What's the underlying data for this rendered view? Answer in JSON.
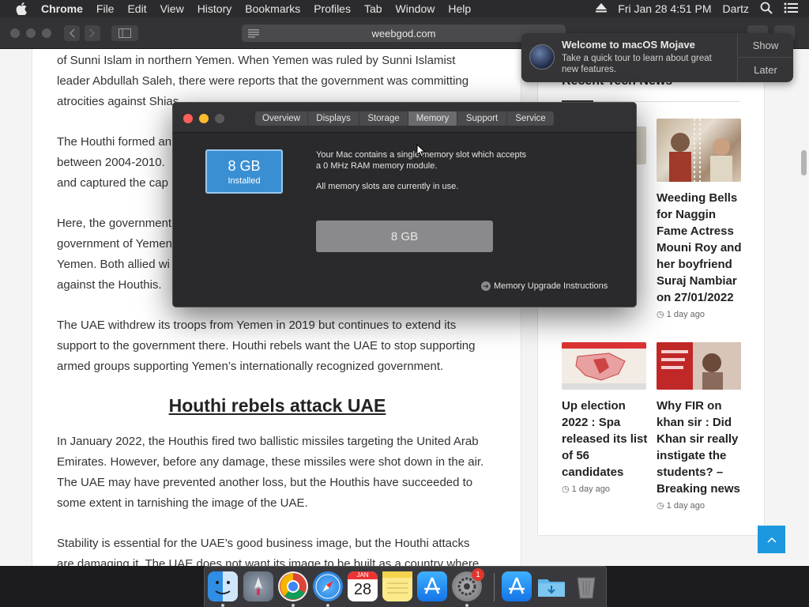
{
  "menubar": {
    "app": "Chrome",
    "items": [
      "File",
      "Edit",
      "View",
      "History",
      "Bookmarks",
      "Profiles",
      "Tab",
      "Window",
      "Help"
    ],
    "datetime": "Fri Jan 28  4:51 PM",
    "user": "Dartz"
  },
  "browser": {
    "url": "weebgod.com"
  },
  "notification": {
    "title": "Welcome to macOS Mojave",
    "body_lines": [
      "Take a quick tour to learn about great",
      "new features."
    ],
    "show_label": "Show",
    "later_label": "Later"
  },
  "article": {
    "paragraphs": [
      {
        "lines": [
          "of Sunni Islam in northern Yemen. When Yemen was ruled by Sunni Islamist",
          "leader Abdullah Saleh, there were reports that the government was committing",
          "atrocities against Shias."
        ]
      },
      {
        "lines": [
          "The Houthi formed an",
          "between 2004-2010.",
          "and captured the cap"
        ]
      },
      {
        "lines": [
          "Here, the government",
          "government of Yemen",
          "Yemen. Both allied wi",
          "against the Houthis."
        ]
      },
      {
        "lines": [
          "The UAE withdrew its troops from Yemen in 2019 but continues to extend its",
          "support to the government there. Houthi rebels want the UAE to stop supporting",
          "armed groups supporting Yemen’s internationally recognized government."
        ]
      },
      {
        "lines": [
          "In January 2022, the Houthis fired two ballistic missiles targeting the United Arab",
          "Emirates. However, before any damage, these missiles were shot down in the air.",
          "The UAE may have prevented another loss, but the Houthis have succeeded to",
          "some extent in tarnishing the image of the UAE."
        ]
      },
      {
        "lines": [
          "Stability is essential for the UAE’s good business image, but the Houthi attacks",
          "are damaging it. The UAE does not want its image to be built as a country where"
        ]
      }
    ],
    "heading": "Houthi rebels attack UAE"
  },
  "sidebar": {
    "widget_title": "Recent Tech News",
    "partial_fragments": [
      "s"
    ],
    "news": [
      {
        "title_lines": [
          "Weeding Bells",
          "for Naggin",
          "Fame Actress",
          "Mouni Roy and",
          "her boyfriend",
          "Suraj Nambiar",
          "on 27/01/2022"
        ],
        "meta": "1 day ago"
      },
      {
        "title_lines": [
          "Up election",
          "2022 : Spa",
          "released its list",
          "of 56",
          "candidates"
        ],
        "meta": "1 day ago"
      },
      {
        "title_lines": [
          "Why FIR on",
          "khan sir : Did",
          "Khan sir really",
          "instigate the",
          "students? –",
          "Breaking news"
        ],
        "meta": "1 day ago"
      }
    ]
  },
  "about_window": {
    "tabs": [
      "Overview",
      "Displays",
      "Storage",
      "Memory",
      "Support",
      "Service"
    ],
    "active_tab": "Memory",
    "installed_amount": "8 GB",
    "installed_label": "Installed",
    "info_lines": [
      "Your Mac contains a single memory slot which accepts",
      "a 0 MHz RAM memory module."
    ],
    "status_line": "All memory slots are currently in use.",
    "slot_label": "8 GB",
    "upgrade_link": "Memory Upgrade Instructions"
  },
  "dock": {
    "calendar_month": "JAN",
    "calendar_day": "28",
    "badge_count": "1"
  },
  "colors": {
    "accent_blue": "#1b98e0",
    "memory_badge": "#3a8fd2",
    "close_red": "#fc5f57",
    "minimize_yellow": "#fdbb2e"
  }
}
